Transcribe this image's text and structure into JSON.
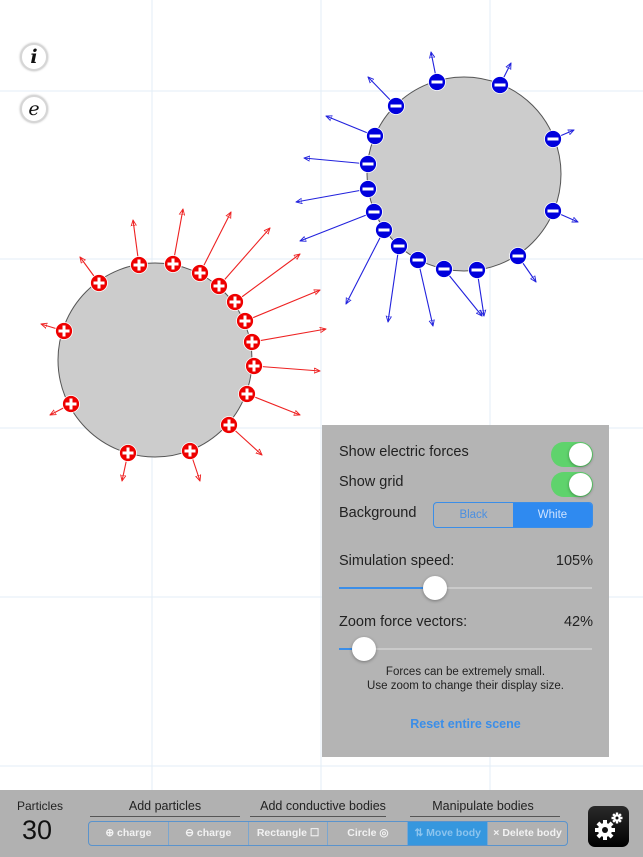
{
  "side_buttons": {
    "info_label": "i",
    "equations_label": "e"
  },
  "colors": {
    "positive": "#ee0000",
    "negative": "#0000dd",
    "body_fill": "#cccccc",
    "grid": "#e3edf7",
    "accent": "#3b8ee8",
    "toggle_on": "#5fd36c"
  },
  "scene": {
    "charge_count": 30,
    "bodies": [
      {
        "type": "circle",
        "label": "positive-body"
      },
      {
        "type": "circle",
        "label": "negative-body"
      }
    ]
  },
  "settings": {
    "show_forces_label": "Show electric forces",
    "show_forces_on": true,
    "show_grid_label": "Show grid",
    "show_grid_on": true,
    "background_label": "Background",
    "background_options": [
      "Black",
      "White"
    ],
    "background_selected": "White",
    "speed_label": "Simulation speed:",
    "speed_value": "105%",
    "speed_fraction": 0.38,
    "zoom_label": "Zoom force vectors:",
    "zoom_value": "42%",
    "zoom_fraction": 0.1,
    "note_line1": "Forces can be extremely small.",
    "note_line2": "Use zoom to change their display size.",
    "reset_label": "Reset entire scene"
  },
  "bottom_bar": {
    "particles_label": "Particles",
    "particles_count": "30",
    "groups": [
      "Add particles",
      "Add conductive bodies",
      "Manipulate bodies"
    ],
    "buttons": [
      {
        "label": "⊕ charge",
        "active": false
      },
      {
        "label": "⊖ charge",
        "active": false
      },
      {
        "label": "Rectangle ☐",
        "active": false
      },
      {
        "label": "Circle ◎",
        "active": false
      },
      {
        "label": "⇅ Move body",
        "active": true
      },
      {
        "label": "× Delete body",
        "active": false
      }
    ],
    "settings_icon": "gear-icon"
  }
}
